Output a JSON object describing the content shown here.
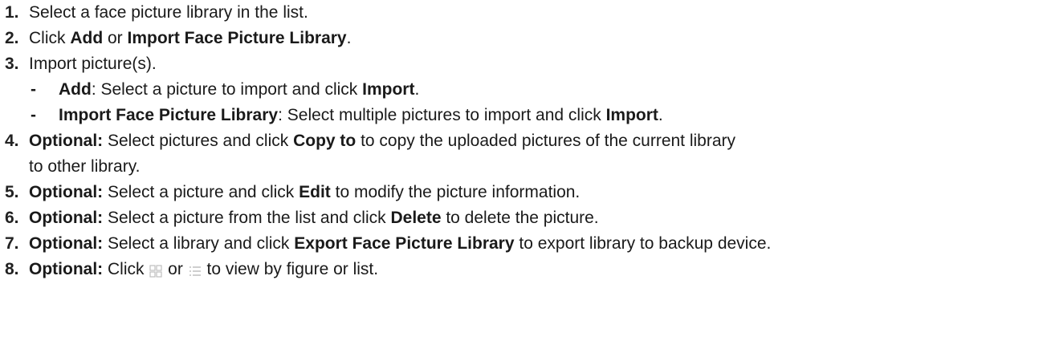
{
  "steps": [
    {
      "num": "1.",
      "parts": [
        {
          "t": "Select a face picture library in the list.",
          "b": false
        }
      ]
    },
    {
      "num": "2.",
      "parts": [
        {
          "t": "Click ",
          "b": false
        },
        {
          "t": "Add",
          "b": true
        },
        {
          "t": " or ",
          "b": false
        },
        {
          "t": "Import Face Picture Library",
          "b": true
        },
        {
          "t": ".",
          "b": false
        }
      ]
    },
    {
      "num": "3.",
      "parts": [
        {
          "t": "Import picture(s).",
          "b": false
        }
      ],
      "sub": [
        [
          {
            "t": "Add",
            "b": true
          },
          {
            "t": ": Select a picture to import and click ",
            "b": false
          },
          {
            "t": "Import",
            "b": true
          },
          {
            "t": ".",
            "b": false
          }
        ],
        [
          {
            "t": "Import Face Picture Library",
            "b": true
          },
          {
            "t": ": Select multiple pictures to import and click ",
            "b": false
          },
          {
            "t": "Import",
            "b": true
          },
          {
            "t": ".",
            "b": false
          }
        ]
      ]
    },
    {
      "num": "4.",
      "parts": [
        {
          "t": "Optional:",
          "b": true
        },
        {
          "t": " Select pictures and click ",
          "b": false
        },
        {
          "t": "Copy to",
          "b": true
        },
        {
          "t": " to copy the uploaded pictures of the current library",
          "b": false
        }
      ],
      "cont": "to other library."
    },
    {
      "num": "5.",
      "parts": [
        {
          "t": "Optional:",
          "b": true
        },
        {
          "t": " Select a picture and click ",
          "b": false
        },
        {
          "t": "Edit",
          "b": true
        },
        {
          "t": " to modify the picture information.",
          "b": false
        }
      ]
    },
    {
      "num": "6.",
      "parts": [
        {
          "t": "Optional:",
          "b": true
        },
        {
          "t": " Select a picture from the list and click ",
          "b": false
        },
        {
          "t": "Delete",
          "b": true
        },
        {
          "t": " to delete the picture.",
          "b": false
        }
      ]
    },
    {
      "num": "7.",
      "parts": [
        {
          "t": "Optional:",
          "b": true
        },
        {
          "t": " Select a library and click ",
          "b": false
        },
        {
          "t": "Export Face Picture Library",
          "b": true
        },
        {
          "t": " to export library to backup device.",
          "b": false
        }
      ]
    },
    {
      "num": "8.",
      "parts": [
        {
          "t": "Optional:",
          "b": true
        },
        {
          "t": " Click ",
          "b": false
        },
        {
          "icon": "grid-view-icon"
        },
        {
          "t": " or ",
          "b": false
        },
        {
          "icon": "list-view-icon"
        },
        {
          "t": " to view by figure or list.",
          "b": false
        }
      ]
    }
  ],
  "sub_marker": "-",
  "icon_color": "#bfbfbf"
}
